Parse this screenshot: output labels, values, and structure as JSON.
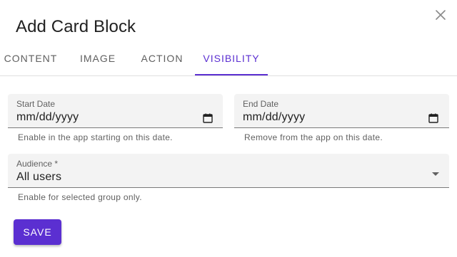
{
  "dialog": {
    "title": "Add Card Block",
    "close_icon": "close-icon"
  },
  "tabs": [
    {
      "label": "CONTENT",
      "active": false
    },
    {
      "label": "IMAGE",
      "active": false
    },
    {
      "label": "ACTION",
      "active": false
    },
    {
      "label": "VISIBILITY",
      "active": true
    }
  ],
  "visibility": {
    "start_date": {
      "label": "Start Date",
      "value": "mm/dd/yyyy",
      "helper": "Enable in the app starting on this date.",
      "icon": "calendar-icon"
    },
    "end_date": {
      "label": "End Date",
      "value": "mm/dd/yyyy",
      "helper": "Remove from the app on this date.",
      "icon": "calendar-icon"
    },
    "audience": {
      "label": "Audience *",
      "value": "All users",
      "helper": "Enable for selected group only.",
      "icon": "dropdown-arrow-icon"
    }
  },
  "actions": {
    "save_label": "SAVE"
  },
  "colors": {
    "accent": "#5b2fd1",
    "field_bg": "#f3f3f3",
    "helper_text": "#616161"
  }
}
